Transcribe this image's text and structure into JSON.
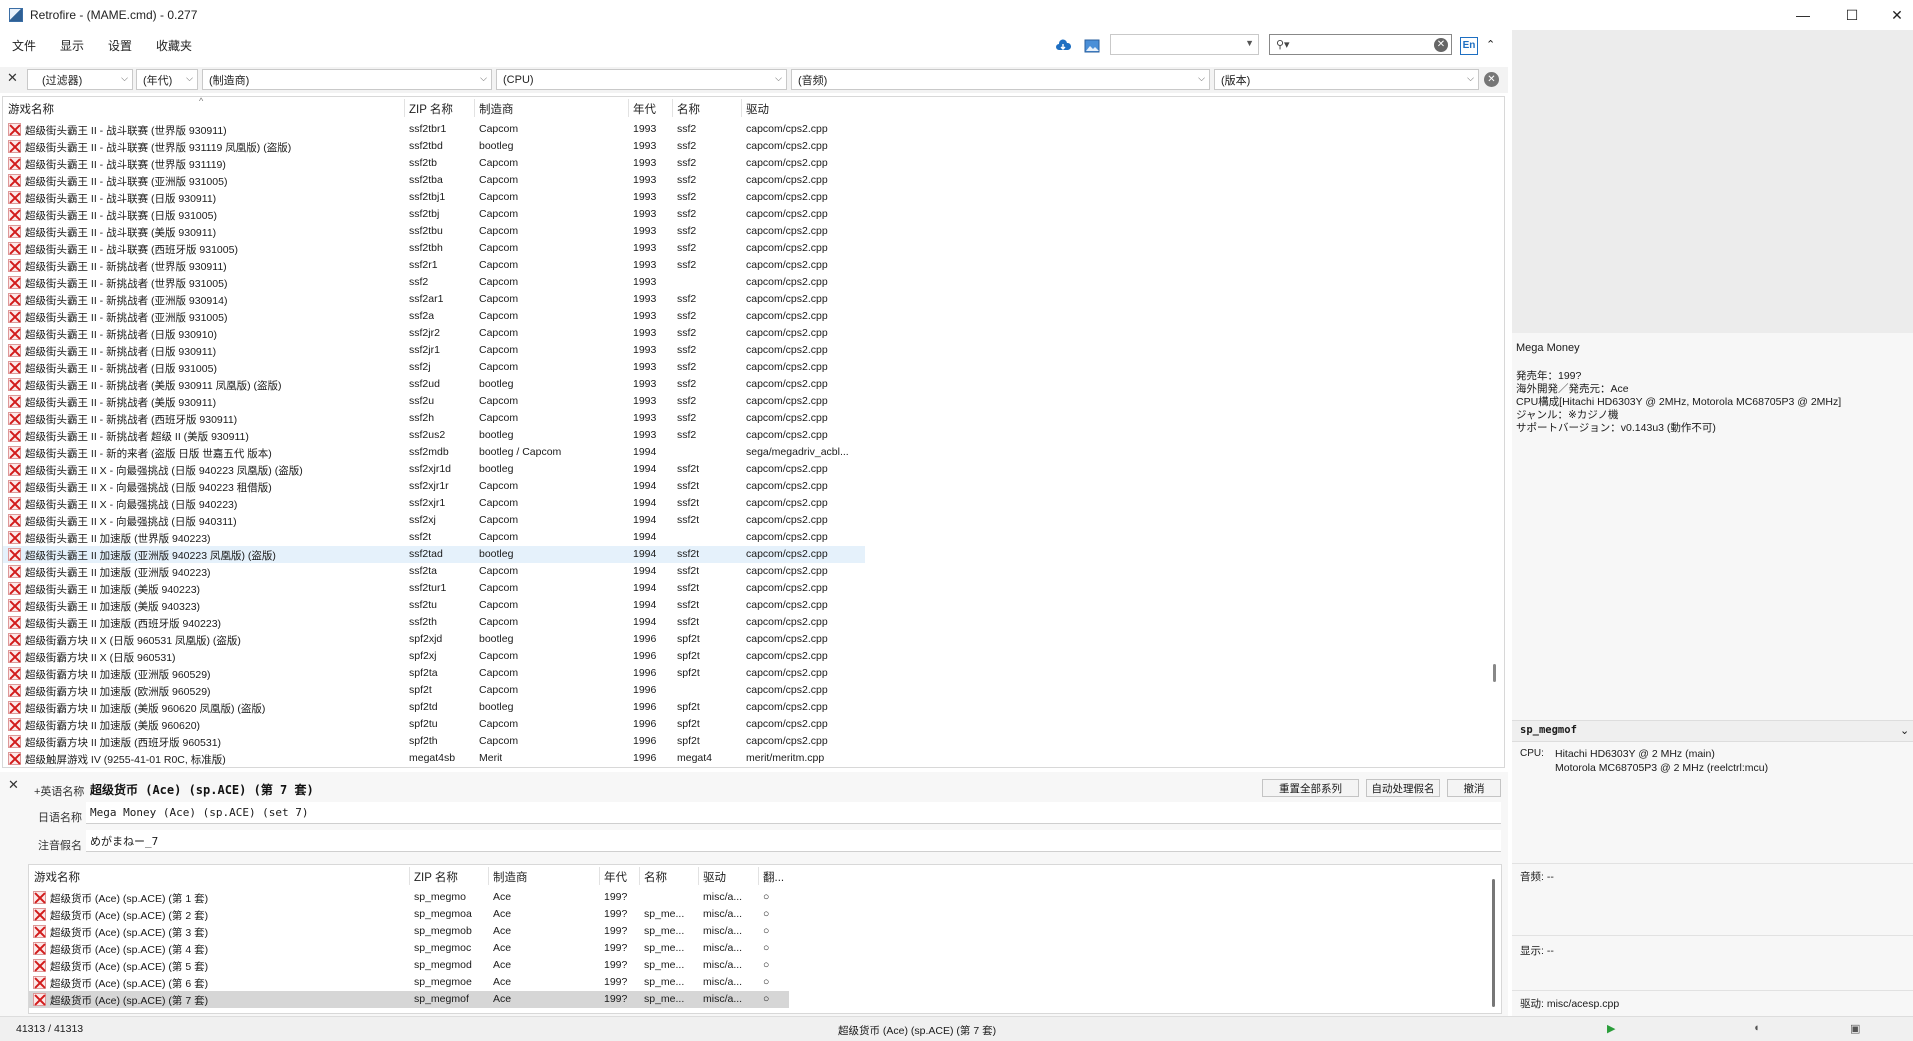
{
  "window": {
    "title": "Retrofire -  (MAME.cmd) - 0.277",
    "min": "—",
    "max": "☐",
    "close": "✕"
  },
  "menu": [
    "文件",
    "显示",
    "设置",
    "收藏夹"
  ],
  "toolbar": {
    "lang_button": "En",
    "search_value": "",
    "dropdown_value": ""
  },
  "filters": {
    "filter": "(过滤器)",
    "year": "(年代)",
    "manufacturer": "(制造商)",
    "cpu": "(CPU)",
    "sound": "(音频)",
    "version": "(版本)"
  },
  "main_list": {
    "columns": [
      "游戏名称",
      "ZIP 名称",
      "制造商",
      "年代",
      "名称",
      "驱动"
    ],
    "rows": [
      [
        "超级街头霸王 II - 战斗联赛 (世界版 930911)",
        "ssf2tbr1",
        "Capcom",
        "1993",
        "ssf2",
        "capcom/cps2.cpp"
      ],
      [
        "超级街头霸王 II - 战斗联赛 (世界版 931119 凤凰版) (盗版)",
        "ssf2tbd",
        "bootleg",
        "1993",
        "ssf2",
        "capcom/cps2.cpp"
      ],
      [
        "超级街头霸王 II - 战斗联赛 (世界版 931119)",
        "ssf2tb",
        "Capcom",
        "1993",
        "ssf2",
        "capcom/cps2.cpp"
      ],
      [
        "超级街头霸王 II - 战斗联赛 (亚洲版 931005)",
        "ssf2tba",
        "Capcom",
        "1993",
        "ssf2",
        "capcom/cps2.cpp"
      ],
      [
        "超级街头霸王 II - 战斗联赛 (日版 930911)",
        "ssf2tbj1",
        "Capcom",
        "1993",
        "ssf2",
        "capcom/cps2.cpp"
      ],
      [
        "超级街头霸王 II - 战斗联赛 (日版 931005)",
        "ssf2tbj",
        "Capcom",
        "1993",
        "ssf2",
        "capcom/cps2.cpp"
      ],
      [
        "超级街头霸王 II - 战斗联赛 (美版 930911)",
        "ssf2tbu",
        "Capcom",
        "1993",
        "ssf2",
        "capcom/cps2.cpp"
      ],
      [
        "超级街头霸王 II - 战斗联赛 (西班牙版 931005)",
        "ssf2tbh",
        "Capcom",
        "1993",
        "ssf2",
        "capcom/cps2.cpp"
      ],
      [
        "超级街头霸王 II - 新挑战者 (世界版 930911)",
        "ssf2r1",
        "Capcom",
        "1993",
        "ssf2",
        "capcom/cps2.cpp"
      ],
      [
        "超级街头霸王 II - 新挑战者 (世界版 931005)",
        "ssf2",
        "Capcom",
        "1993",
        "",
        "capcom/cps2.cpp"
      ],
      [
        "超级街头霸王 II - 新挑战者 (亚洲版 930914)",
        "ssf2ar1",
        "Capcom",
        "1993",
        "ssf2",
        "capcom/cps2.cpp"
      ],
      [
        "超级街头霸王 II - 新挑战者 (亚洲版 931005)",
        "ssf2a",
        "Capcom",
        "1993",
        "ssf2",
        "capcom/cps2.cpp"
      ],
      [
        "超级街头霸王 II - 新挑战者 (日版 930910)",
        "ssf2jr2",
        "Capcom",
        "1993",
        "ssf2",
        "capcom/cps2.cpp"
      ],
      [
        "超级街头霸王 II - 新挑战者 (日版 930911)",
        "ssf2jr1",
        "Capcom",
        "1993",
        "ssf2",
        "capcom/cps2.cpp"
      ],
      [
        "超级街头霸王 II - 新挑战者 (日版 931005)",
        "ssf2j",
        "Capcom",
        "1993",
        "ssf2",
        "capcom/cps2.cpp"
      ],
      [
        "超级街头霸王 II - 新挑战者 (美版 930911 凤凰版) (盗版)",
        "ssf2ud",
        "bootleg",
        "1993",
        "ssf2",
        "capcom/cps2.cpp"
      ],
      [
        "超级街头霸王 II - 新挑战者 (美版 930911)",
        "ssf2u",
        "Capcom",
        "1993",
        "ssf2",
        "capcom/cps2.cpp"
      ],
      [
        "超级街头霸王 II - 新挑战者 (西班牙版 930911)",
        "ssf2h",
        "Capcom",
        "1993",
        "ssf2",
        "capcom/cps2.cpp"
      ],
      [
        "超级街头霸王 II - 新挑战者 超级 II (美版 930911)",
        "ssf2us2",
        "bootleg",
        "1993",
        "ssf2",
        "capcom/cps2.cpp"
      ],
      [
        "超级街头霸王 II - 新的来者 (盗版 日版 世嘉五代 版本)",
        "ssf2mdb",
        "bootleg / Capcom",
        "1994",
        "",
        "sega/megadriv_acbl..."
      ],
      [
        "超级街头霸王 II X - 向最强挑战 (日版 940223 凤凰版) (盗版)",
        "ssf2xjr1d",
        "bootleg",
        "1994",
        "ssf2t",
        "capcom/cps2.cpp"
      ],
      [
        "超级街头霸王 II X - 向最强挑战 (日版 940223 租借版)",
        "ssf2xjr1r",
        "Capcom",
        "1994",
        "ssf2t",
        "capcom/cps2.cpp"
      ],
      [
        "超级街头霸王 II X - 向最强挑战 (日版 940223)",
        "ssf2xjr1",
        "Capcom",
        "1994",
        "ssf2t",
        "capcom/cps2.cpp"
      ],
      [
        "超级街头霸王 II X - 向最强挑战 (日版 940311)",
        "ssf2xj",
        "Capcom",
        "1994",
        "ssf2t",
        "capcom/cps2.cpp"
      ],
      [
        "超级街头霸王 II 加速版 (世界版 940223)",
        "ssf2t",
        "Capcom",
        "1994",
        "",
        "capcom/cps2.cpp"
      ],
      [
        "超级街头霸王 II 加速版 (亚洲版 940223 凤凰版) (盗版)",
        "ssf2tad",
        "bootleg",
        "1994",
        "ssf2t",
        "capcom/cps2.cpp"
      ],
      [
        "超级街头霸王 II 加速版 (亚洲版 940223)",
        "ssf2ta",
        "Capcom",
        "1994",
        "ssf2t",
        "capcom/cps2.cpp"
      ],
      [
        "超级街头霸王 II 加速版 (美版 940223)",
        "ssf2tur1",
        "Capcom",
        "1994",
        "ssf2t",
        "capcom/cps2.cpp"
      ],
      [
        "超级街头霸王 II 加速版 (美版 940323)",
        "ssf2tu",
        "Capcom",
        "1994",
        "ssf2t",
        "capcom/cps2.cpp"
      ],
      [
        "超级街头霸王 II 加速版 (西班牙版 940223)",
        "ssf2th",
        "Capcom",
        "1994",
        "ssf2t",
        "capcom/cps2.cpp"
      ],
      [
        "超级街霸方块 II X (日版 960531 凤凰版) (盗版)",
        "spf2xjd",
        "bootleg",
        "1996",
        "spf2t",
        "capcom/cps2.cpp"
      ],
      [
        "超级街霸方块 II X (日版 960531)",
        "spf2xj",
        "Capcom",
        "1996",
        "spf2t",
        "capcom/cps2.cpp"
      ],
      [
        "超级街霸方块 II 加速版 (亚洲版 960529)",
        "spf2ta",
        "Capcom",
        "1996",
        "spf2t",
        "capcom/cps2.cpp"
      ],
      [
        "超级街霸方块 II 加速版 (欧洲版 960529)",
        "spf2t",
        "Capcom",
        "1996",
        "",
        "capcom/cps2.cpp"
      ],
      [
        "超级街霸方块 II 加速版 (美版 960620 凤凰版) (盗版)",
        "spf2td",
        "bootleg",
        "1996",
        "spf2t",
        "capcom/cps2.cpp"
      ],
      [
        "超级街霸方块 II 加速版 (美版 960620)",
        "spf2tu",
        "Capcom",
        "1996",
        "spf2t",
        "capcom/cps2.cpp"
      ],
      [
        "超级街霸方块 II 加速版 (西班牙版 960531)",
        "spf2th",
        "Capcom",
        "1996",
        "spf2t",
        "capcom/cps2.cpp"
      ],
      [
        "超级触屏游戏 IV (9255-41-01 R0C, 标准版)",
        "megat4sb",
        "Merit",
        "1996",
        "megat4",
        "merit/meritm.cpp"
      ]
    ]
  },
  "right_info": {
    "title": "Mega Money",
    "lines": [
      "発売年：199?",
      "海外開発／発売元：Ace",
      "CPU構成[Hitachi HD6303Y @ 2MHz, Motorola MC68705P3 @ 2MHz]",
      "ジャンル：※カジノ機",
      "サポートバージョン：v0.143u3 (動作不可)"
    ]
  },
  "right_detail": {
    "header": "sp_megmof",
    "cpu_label": "CPU:",
    "cpu_lines": [
      "Hitachi HD6303Y @ 2 MHz (main)",
      "Motorola MC68705P3 @ 2 MHz (reelctrl:mcu)"
    ],
    "sound": "音频: --",
    "display": "显示: --",
    "driver": "驱动:  misc/acesp.cpp"
  },
  "detail": {
    "label_en": "+英语名称",
    "value_en": "超级货币 (Ace) (sp.ACE) (第 7 套)",
    "label_jp": "日语名称",
    "value_jp": "Mega Money (Ace) (sp.ACE) (set 7)",
    "label_phon": "注音假名",
    "value_phon": "めがまねー_7",
    "btn_reset": "重置全部系列",
    "btn_auto": "自动处理假名",
    "btn_cancel": "撤消"
  },
  "sub_list": {
    "columns": [
      "游戏名称",
      "ZIP 名称",
      "制造商",
      "年代",
      "名称",
      "驱动",
      "翻..."
    ],
    "rows": [
      [
        "超级货币 (Ace) (sp.ACE) (第 1 套)",
        "sp_megmo",
        "Ace",
        "199?",
        "",
        "misc/a...",
        "○"
      ],
      [
        "超级货币 (Ace) (sp.ACE) (第 2 套)",
        "sp_megmoa",
        "Ace",
        "199?",
        "sp_me...",
        "misc/a...",
        "○"
      ],
      [
        "超级货币 (Ace) (sp.ACE) (第 3 套)",
        "sp_megmob",
        "Ace",
        "199?",
        "sp_me...",
        "misc/a...",
        "○"
      ],
      [
        "超级货币 (Ace) (sp.ACE) (第 4 套)",
        "sp_megmoc",
        "Ace",
        "199?",
        "sp_me...",
        "misc/a...",
        "○"
      ],
      [
        "超级货币 (Ace) (sp.ACE) (第 5 套)",
        "sp_megmod",
        "Ace",
        "199?",
        "sp_me...",
        "misc/a...",
        "○"
      ],
      [
        "超级货币 (Ace) (sp.ACE) (第 6 套)",
        "sp_megmoe",
        "Ace",
        "199?",
        "sp_me...",
        "misc/a...",
        "○"
      ],
      [
        "超级货币 (Ace) (sp.ACE) (第 7 套)",
        "sp_megmof",
        "Ace",
        "199?",
        "sp_me...",
        "misc/a...",
        "○"
      ]
    ]
  },
  "status": {
    "count": "41313 / 41313",
    "current": "超级货币 (Ace) (sp.ACE) (第 7 套)"
  }
}
